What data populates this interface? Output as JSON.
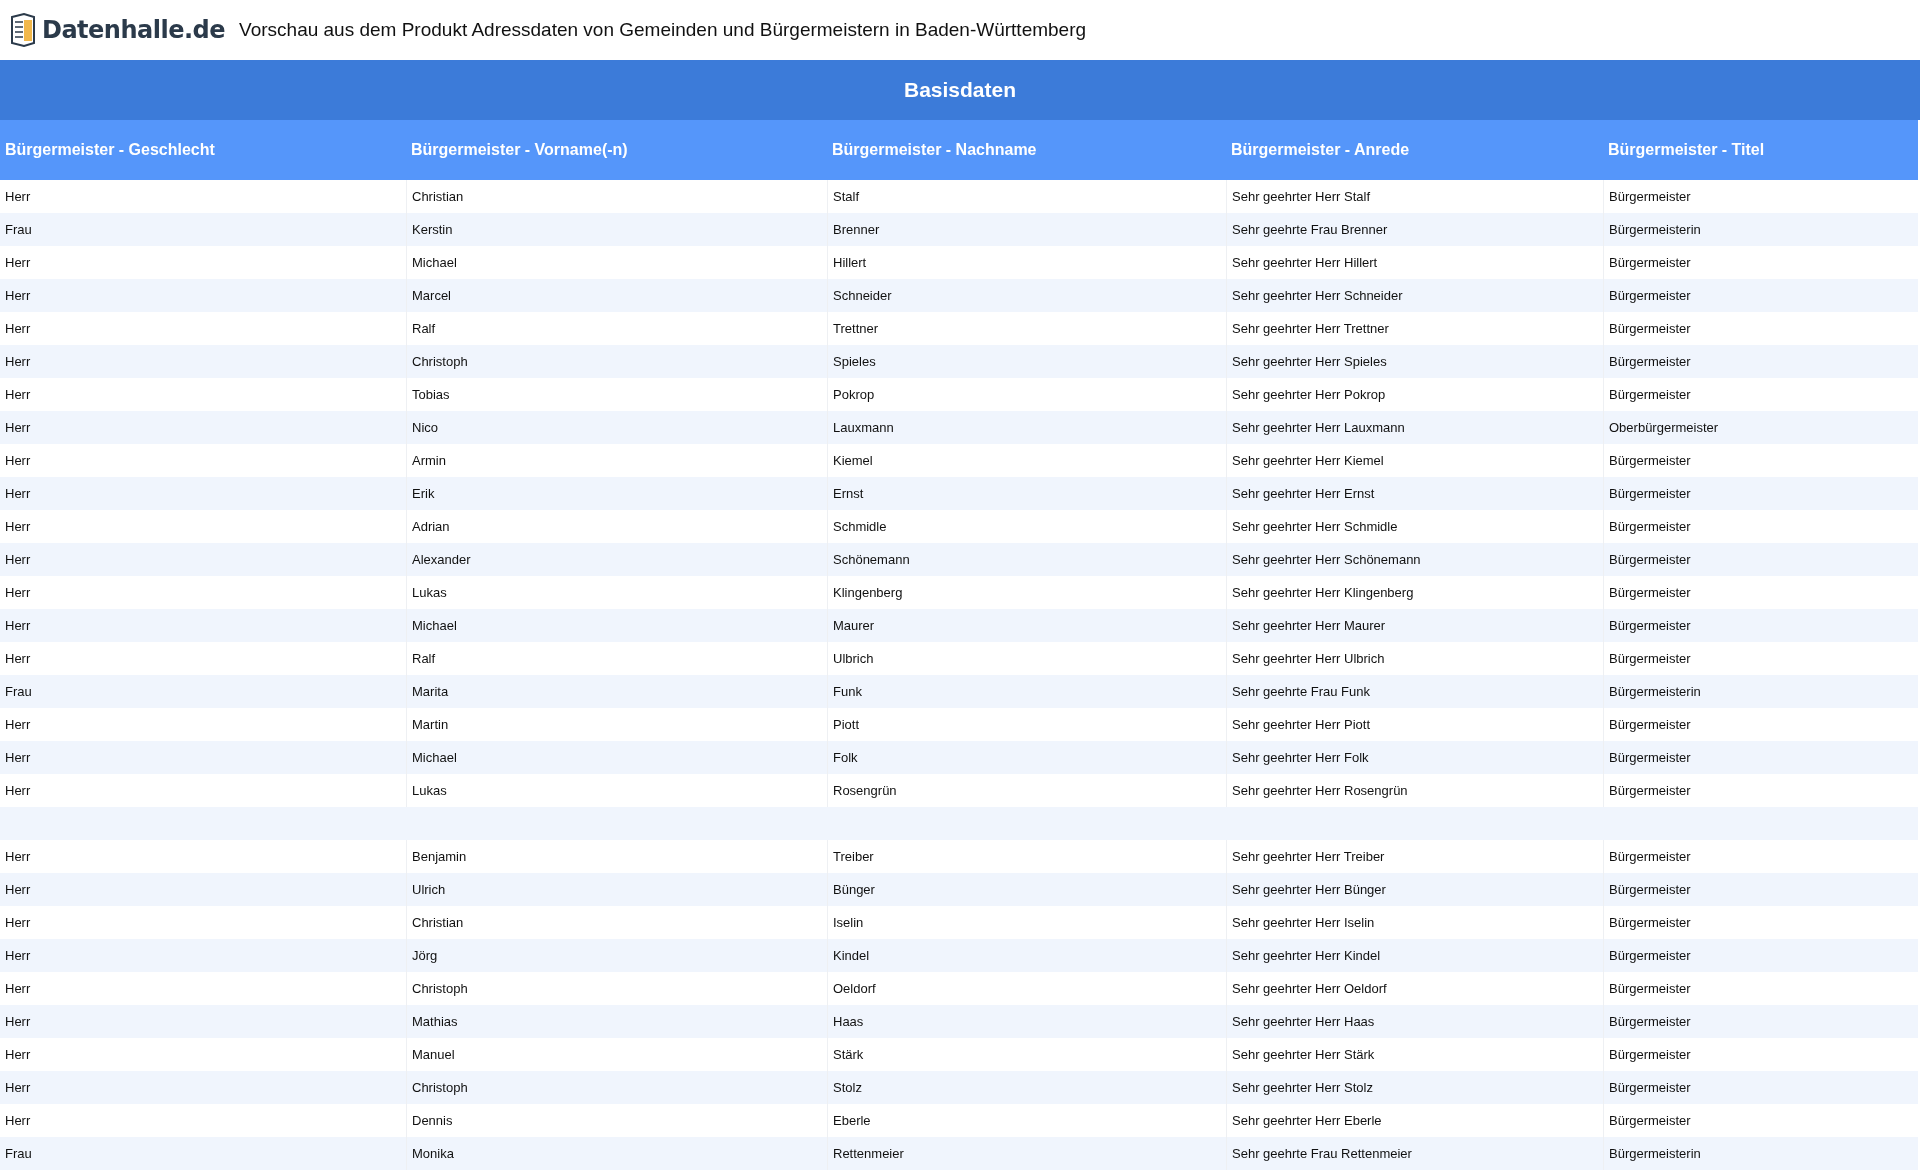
{
  "header": {
    "brand": "Datenhalle.de",
    "title": "Vorschau aus dem Produkt Adressdaten von Gemeinden und Bürgermeistern in Baden-Württemberg"
  },
  "table": {
    "caption": "Basisdaten",
    "columns": [
      "Bürgermeister - Geschlecht",
      "Bürgermeister - Vorname(-n)",
      "Bürgermeister - Nachname",
      "Bürgermeister - Anrede",
      "Bürgermeister - Titel"
    ],
    "rows": [
      {
        "kind": "data",
        "cells": [
          "Herr",
          "Christian",
          "Stalf",
          "Sehr geehrter Herr Stalf",
          "Bürgermeister"
        ]
      },
      {
        "kind": "data",
        "cells": [
          "Frau",
          "Kerstin",
          "Brenner",
          "Sehr geehrte Frau Brenner",
          "Bürgermeisterin"
        ]
      },
      {
        "kind": "data",
        "cells": [
          "Herr",
          "Michael",
          "Hillert",
          "Sehr geehrter Herr Hillert",
          "Bürgermeister"
        ]
      },
      {
        "kind": "data",
        "cells": [
          "Herr",
          "Marcel",
          "Schneider",
          "Sehr geehrter Herr Schneider",
          "Bürgermeister"
        ]
      },
      {
        "kind": "data",
        "cells": [
          "Herr",
          "Ralf",
          "Trettner",
          "Sehr geehrter Herr Trettner",
          "Bürgermeister"
        ]
      },
      {
        "kind": "data",
        "cells": [
          "Herr",
          "Christoph",
          "Spieles",
          "Sehr geehrter Herr Spieles",
          "Bürgermeister"
        ]
      },
      {
        "kind": "data",
        "cells": [
          "Herr",
          "Tobias",
          "Pokrop",
          "Sehr geehrter Herr Pokrop",
          "Bürgermeister"
        ]
      },
      {
        "kind": "data",
        "cells": [
          "Herr",
          "Nico",
          "Lauxmann",
          "Sehr geehrter Herr Lauxmann",
          "Oberbürgermeister"
        ]
      },
      {
        "kind": "data",
        "cells": [
          "Herr",
          "Armin",
          "Kiemel",
          "Sehr geehrter Herr Kiemel",
          "Bürgermeister"
        ]
      },
      {
        "kind": "data",
        "cells": [
          "Herr",
          "Erik",
          "Ernst",
          "Sehr geehrter Herr Ernst",
          "Bürgermeister"
        ]
      },
      {
        "kind": "data",
        "cells": [
          "Herr",
          "Adrian",
          "Schmidle",
          "Sehr geehrter Herr Schmidle",
          "Bürgermeister"
        ]
      },
      {
        "kind": "data",
        "cells": [
          "Herr",
          "Alexander",
          "Schönemann",
          "Sehr geehrter Herr Schönemann",
          "Bürgermeister"
        ]
      },
      {
        "kind": "data",
        "cells": [
          "Herr",
          "Lukas",
          "Klingenberg",
          "Sehr geehrter Herr Klingenberg",
          "Bürgermeister"
        ]
      },
      {
        "kind": "data",
        "cells": [
          "Herr",
          "Michael",
          "Maurer",
          "Sehr geehrter Herr Maurer",
          "Bürgermeister"
        ]
      },
      {
        "kind": "data",
        "cells": [
          "Herr",
          "Ralf",
          "Ulbrich",
          "Sehr geehrter Herr Ulbrich",
          "Bürgermeister"
        ]
      },
      {
        "kind": "data",
        "cells": [
          "Frau",
          "Marita",
          "Funk",
          "Sehr geehrte Frau Funk",
          "Bürgermeisterin"
        ]
      },
      {
        "kind": "data",
        "cells": [
          "Herr",
          "Martin",
          "Piott",
          "Sehr geehrter Herr Piott",
          "Bürgermeister"
        ]
      },
      {
        "kind": "data",
        "cells": [
          "Herr",
          "Michael",
          "Folk",
          "Sehr geehrter Herr Folk",
          "Bürgermeister"
        ]
      },
      {
        "kind": "data",
        "cells": [
          "Herr",
          "Lukas",
          "Rosengrün",
          "Sehr geehrter Herr Rosengrün",
          "Bürgermeister"
        ]
      },
      {
        "kind": "blank"
      },
      {
        "kind": "data",
        "cells": [
          "Herr",
          "Benjamin",
          "Treiber",
          "Sehr geehrter Herr Treiber",
          "Bürgermeister"
        ]
      },
      {
        "kind": "data",
        "cells": [
          "Herr",
          "Ulrich",
          "Bünger",
          "Sehr geehrter Herr Bünger",
          "Bürgermeister"
        ]
      },
      {
        "kind": "data",
        "cells": [
          "Herr",
          "Christian",
          "Iselin",
          "Sehr geehrter Herr Iselin",
          "Bürgermeister"
        ]
      },
      {
        "kind": "data",
        "cells": [
          "Herr",
          "Jörg",
          "Kindel",
          "Sehr geehrter Herr Kindel",
          "Bürgermeister"
        ]
      },
      {
        "kind": "data",
        "cells": [
          "Herr",
          "Christoph",
          "Oeldorf",
          "Sehr geehrter Herr Oeldorf",
          "Bürgermeister"
        ]
      },
      {
        "kind": "data",
        "cells": [
          "Herr",
          "Mathias",
          "Haas",
          "Sehr geehrter Herr Haas",
          "Bürgermeister"
        ]
      },
      {
        "kind": "data",
        "cells": [
          "Herr",
          "Manuel",
          "Stärk",
          "Sehr geehrter Herr Stärk",
          "Bürgermeister"
        ]
      },
      {
        "kind": "data",
        "cells": [
          "Herr",
          "Christoph",
          "Stolz",
          "Sehr geehrter Herr Stolz",
          "Bürgermeister"
        ]
      },
      {
        "kind": "data",
        "cells": [
          "Herr",
          "Dennis",
          "Eberle",
          "Sehr geehrter Herr Eberle",
          "Bürgermeister"
        ]
      },
      {
        "kind": "data",
        "cells": [
          "Frau",
          "Monika",
          "Rettenmeier",
          "Sehr geehrte Frau Rettenmeier",
          "Bürgermeisterin"
        ]
      }
    ]
  }
}
